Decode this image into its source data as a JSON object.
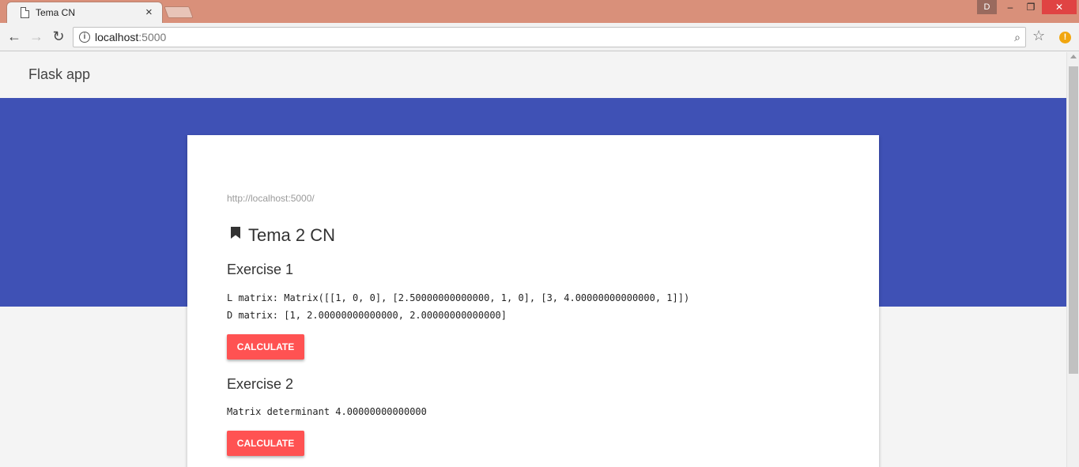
{
  "browser": {
    "tab_title": "Tema CN",
    "tab_close": "×",
    "user_initial": "D",
    "minimize": "‒",
    "restore": "❐",
    "close": "✕",
    "url_host": "localhost",
    "url_port": ":5000",
    "back": "←",
    "forward": "→",
    "reload": "↻",
    "zoom": "⌕",
    "star": "☆",
    "ext": "!"
  },
  "app": {
    "title": "Flask app"
  },
  "card": {
    "url": "http://localhost:5000/",
    "title": "Tema 2 CN",
    "exercises": [
      {
        "title": "Exercise 1",
        "lines": [
          "L matrix: Matrix([[1, 0, 0], [2.50000000000000, 1, 0], [3, 4.00000000000000, 1]])",
          "D matrix: [1, 2.00000000000000, 2.00000000000000]"
        ],
        "button": "CALCULATE"
      },
      {
        "title": "Exercise 2",
        "lines": [
          "Matrix determinant 4.00000000000000"
        ],
        "button": "CALCULATE"
      }
    ]
  },
  "colors": {
    "hero": "#3f51b5",
    "button": "#ff5252",
    "titlebar": "#d9907a"
  }
}
